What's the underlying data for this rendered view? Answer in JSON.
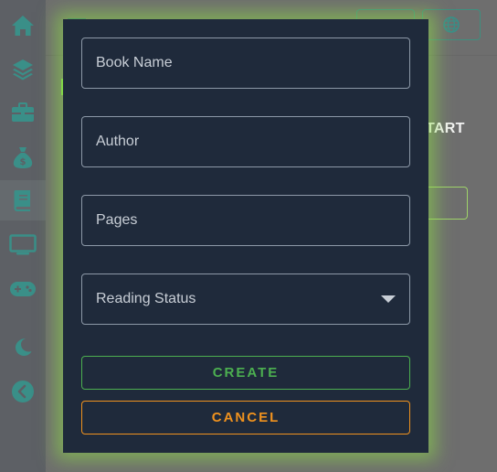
{
  "sidebar": {
    "items": [
      {
        "icon": "home-icon"
      },
      {
        "icon": "layers-icon"
      },
      {
        "icon": "briefcase-icon"
      },
      {
        "icon": "money-bag-icon"
      },
      {
        "icon": "book-icon",
        "active": true
      },
      {
        "icon": "monitor-icon"
      },
      {
        "icon": "gamepad-icon"
      }
    ],
    "theme_toggle_icon": "moon-icon",
    "collapse_icon": "chevron-left-icon",
    "icon_color": "#3a8f88"
  },
  "background": {
    "heading_fragment": "TART",
    "globe_icon": "globe-icon"
  },
  "modal": {
    "fields": {
      "book_name": {
        "placeholder": "Book Name",
        "value": ""
      },
      "author": {
        "placeholder": "Author",
        "value": ""
      },
      "pages": {
        "placeholder": "Pages",
        "value": ""
      },
      "reading_status": {
        "placeholder": "Reading Status",
        "value": ""
      }
    },
    "create_label": "CREATE",
    "cancel_label": "CANCEL",
    "colors": {
      "background": "#1f2a3b",
      "create": "#4caf50",
      "cancel": "#f0921e",
      "glow": "#8cde46"
    }
  }
}
